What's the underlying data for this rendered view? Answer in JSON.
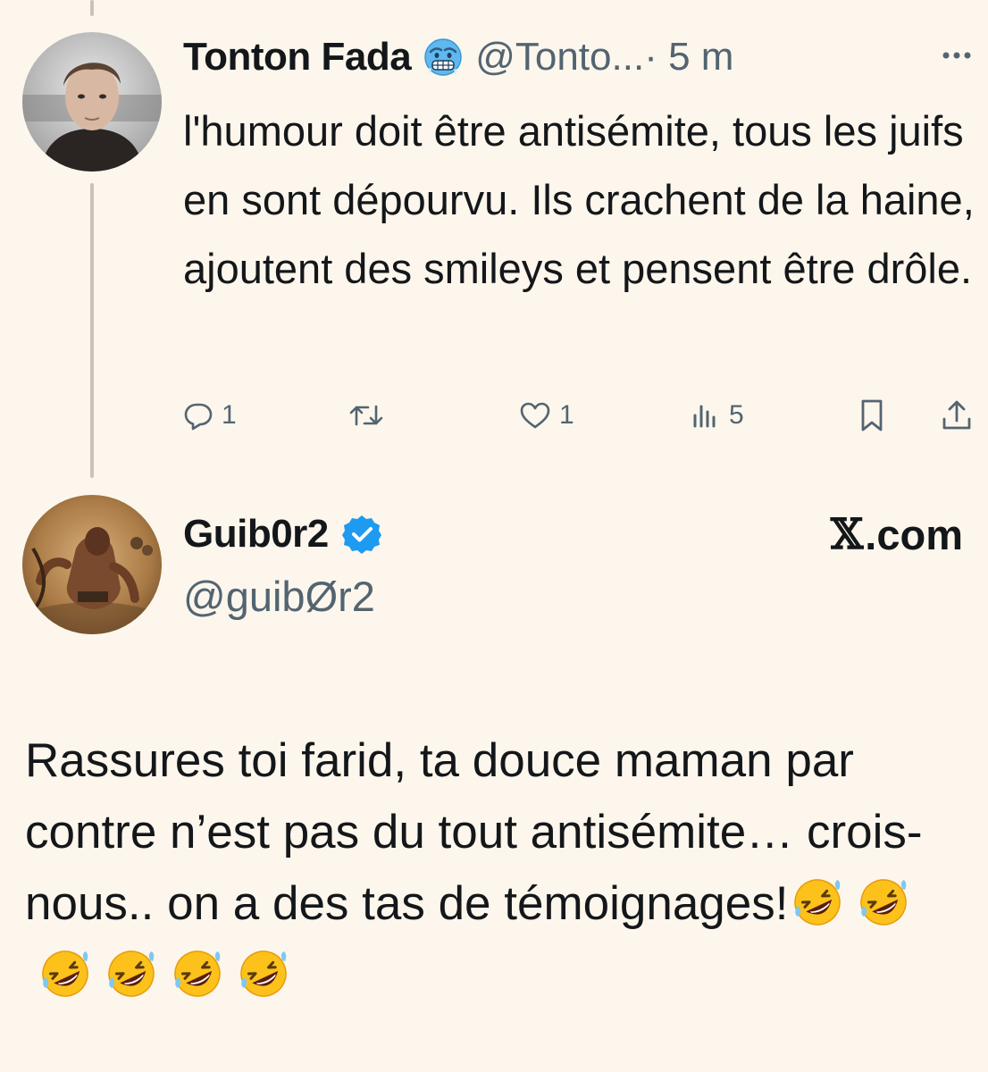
{
  "tweet1": {
    "name": "Tonton Fada",
    "handle": "@Tonto...",
    "time": "· 5 m",
    "text": "l'humour doit être antisémite, tous les juifs en sont dépourvu. Ils crachent de la haine, ajoutent des smileys et pensent être drôle.",
    "badge_icon": "cold-face-emoji",
    "actions": {
      "reply_count": "1",
      "retweet_count": "",
      "like_count": "1",
      "views_count": "5"
    }
  },
  "tweet2": {
    "name": "Guib0r2",
    "handle": "@guibØr2",
    "source": ".com",
    "source_logo": "𝕏",
    "text": "Rassures toi farid, ta douce maman par contre n’est pas du tout antisémite… crois-nous.. on a des tas de témoignages!",
    "emoji_icon": "rolling-on-floor-laughing-emoji",
    "emoji_count": 6,
    "verified_icon": "verified-badge-icon"
  },
  "colors": {
    "background": "#fcf6ec",
    "text": "#14171a",
    "muted": "#536471",
    "verified": "#1d9bf0",
    "thread_line": "#c9c3bb"
  }
}
